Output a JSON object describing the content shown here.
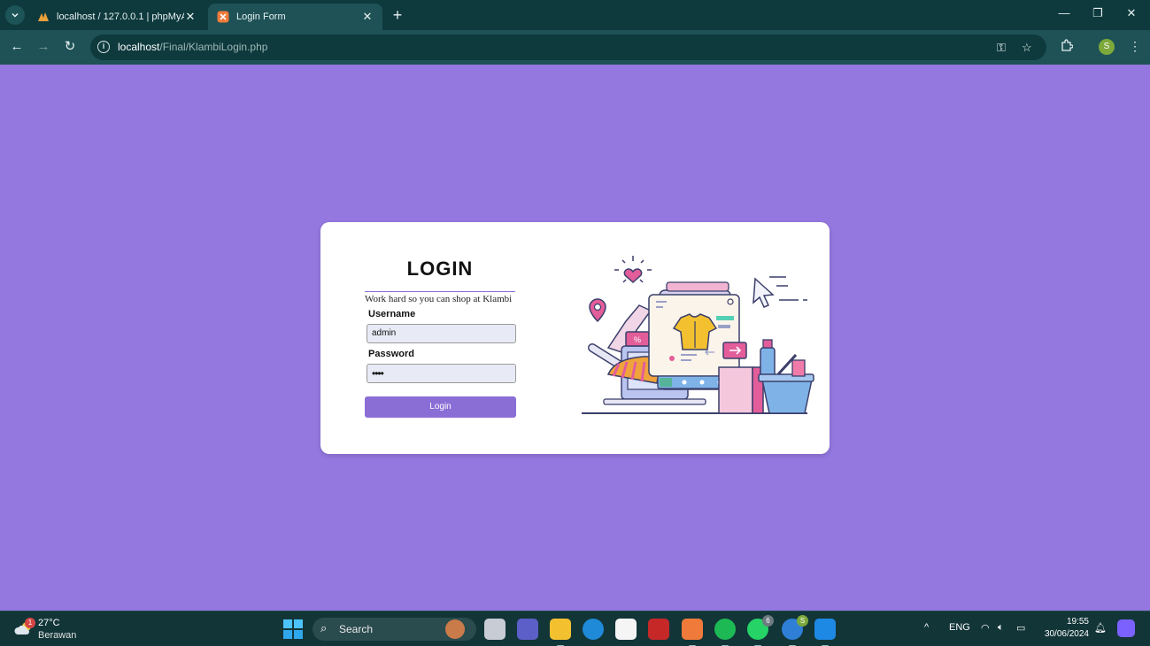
{
  "browser": {
    "tabs": [
      {
        "title": "localhost / 127.0.0.1 | phpMyAd",
        "active": false
      },
      {
        "title": "Login Form",
        "active": true
      }
    ],
    "url_host": "localhost",
    "url_path": "/Final/KlambiLogin.php",
    "profile_initial": "S"
  },
  "login": {
    "title": "LOGIN",
    "tagline": "Work hard so you can shop at Klambi",
    "username_label": "Username",
    "username_value": "admin",
    "password_label": "Password",
    "password_value": "••••",
    "button_label": "Login"
  },
  "colors": {
    "page_background": "#9478e0",
    "button": "#8a6ed6",
    "chrome_dark": "#0e3a3d",
    "chrome_toolbar": "#1e5257"
  },
  "taskbar": {
    "weather_temp": "27°C",
    "weather_condition": "Berawan",
    "weather_badge": "1",
    "search_label": "Search",
    "whatsapp_badge": "6",
    "chrome_badge": "S",
    "language": "ENG",
    "time": "19:55",
    "date": "30/06/2024"
  }
}
